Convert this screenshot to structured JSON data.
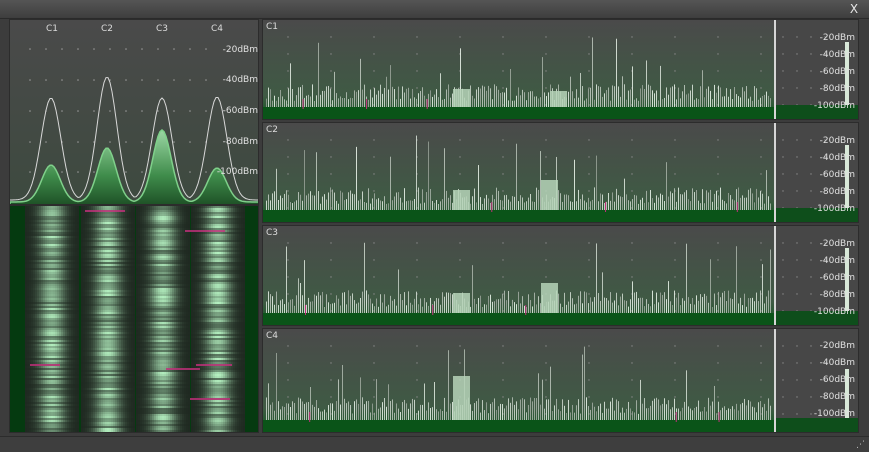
{
  "window": {
    "close_label": "X"
  },
  "overview": {
    "channels": [
      "C1",
      "C2",
      "C3",
      "C4"
    ],
    "db_scale": [
      "-20dBm",
      "-40dBm",
      "-60dBm",
      "-80dBm",
      "-100dBm"
    ]
  },
  "channel_rows": [
    {
      "label": "C1",
      "db_scale": [
        "-20dBm",
        "-40dBm",
        "-60dBm",
        "-80dBm",
        "-100dBm"
      ]
    },
    {
      "label": "C2",
      "db_scale": [
        "-20dBm",
        "-40dBm",
        "-60dBm",
        "-80dBm",
        "-100dBm"
      ]
    },
    {
      "label": "C3",
      "db_scale": [
        "-20dBm",
        "-40dBm",
        "-60dBm",
        "-80dBm",
        "-100dBm"
      ]
    },
    {
      "label": "C4",
      "db_scale": [
        "-20dBm",
        "-40dBm",
        "-60dBm",
        "-80dBm",
        "-100dBm"
      ]
    }
  ],
  "colors": {
    "background": "#3c3c3c",
    "panel": "#484848",
    "trace": "#e8e8e8",
    "fill_green": "#2f7a3c",
    "marker_magenta": "#c0307a",
    "waterfall_base": "#053a10"
  },
  "icons": {
    "close": "close-icon",
    "resize_grip": "resize-grip-icon"
  }
}
